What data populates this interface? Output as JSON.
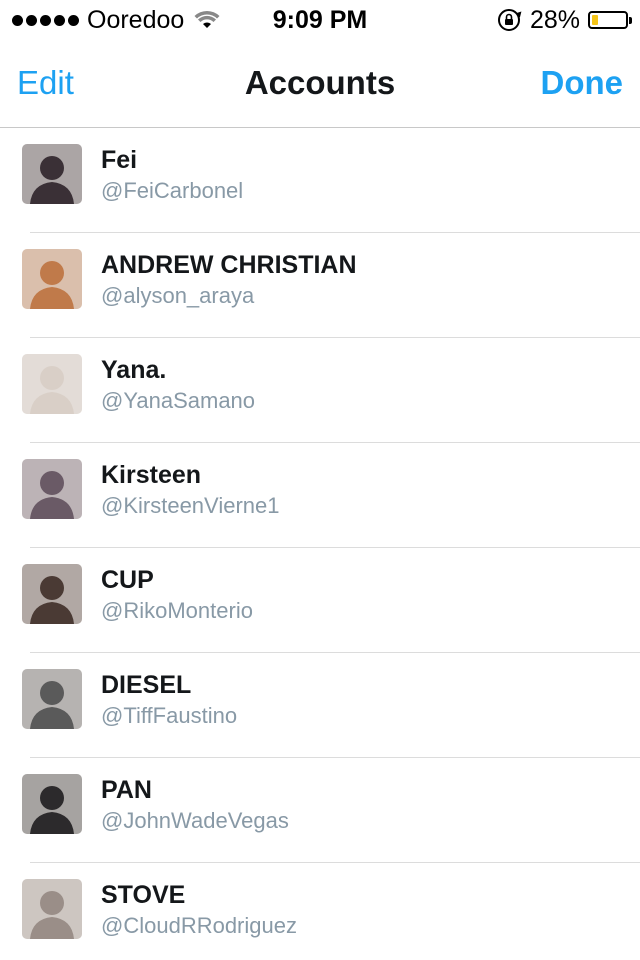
{
  "status_bar": {
    "carrier": "Ooredoo",
    "time": "9:09 PM",
    "battery_percent_label": "28%",
    "battery_level": 0.28,
    "signal_bars": 5,
    "icons": [
      "signal-dots",
      "wifi-icon",
      "rotation-lock-icon",
      "battery-icon"
    ]
  },
  "nav": {
    "edit_label": "Edit",
    "title": "Accounts",
    "done_label": "Done"
  },
  "accounts": [
    {
      "name": "Fei",
      "handle": "@FeiCarbonel",
      "avatar_color": "#3a3036"
    },
    {
      "name": "ANDREW CHRISTIAN",
      "handle": "@alyson_araya",
      "avatar_color": "#c07a4a"
    },
    {
      "name": "Yana.",
      "handle": "@YanaSamano",
      "avatar_color": "#d9cfc7"
    },
    {
      "name": "Kirsteen",
      "handle": "@KirsteenVierne1",
      "avatar_color": "#6a5a66"
    },
    {
      "name": "CUP",
      "handle": "@RikoMonterio",
      "avatar_color": "#4a3a34"
    },
    {
      "name": "DIESEL",
      "handle": "@TiffFaustino",
      "avatar_color": "#5a5a5a"
    },
    {
      "name": "PAN",
      "handle": "@JohnWadeVegas",
      "avatar_color": "#2c2a2c"
    },
    {
      "name": "STOVE",
      "handle": "@CloudRRodriguez",
      "avatar_color": "#9a8e88"
    }
  ],
  "colors": {
    "accent": "#1da1f2",
    "handle_gray": "#8899a6",
    "battery_yellow": "#f5c518"
  }
}
